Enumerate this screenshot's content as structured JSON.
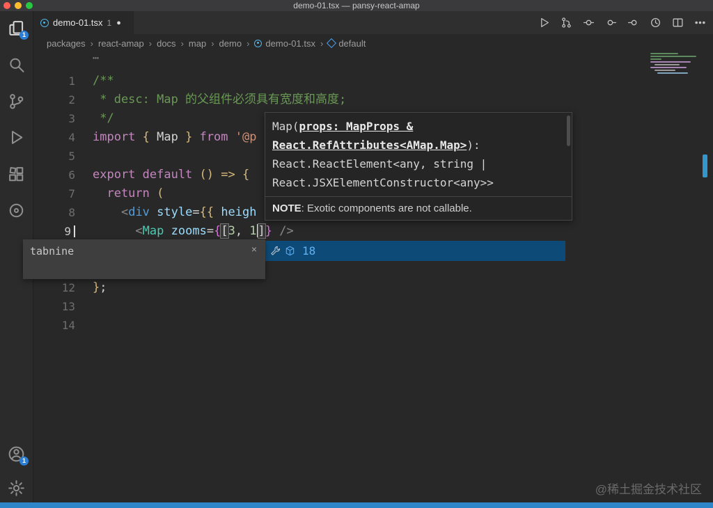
{
  "window": {
    "title": "demo-01.tsx — pansy-react-amap"
  },
  "tab": {
    "label": "demo-01.tsx",
    "count": "1",
    "modified": "●"
  },
  "toolbar": {
    "icons": [
      "run-icon",
      "open-changes-icon",
      "toolbar-circle-icon-1",
      "toolbar-circle-icon-2",
      "toolbar-circle-icon-3",
      "history-icon",
      "split-editor-icon",
      "more-actions-icon"
    ]
  },
  "activity": {
    "items": [
      "explorer-icon",
      "search-icon",
      "source-control-icon",
      "run-debug-icon",
      "extensions-icon",
      "circle-extension-icon",
      "accounts-icon",
      "settings-gear-icon"
    ],
    "explorer_badge": "1",
    "account_badge": "1"
  },
  "breadcrumb": {
    "separator": "›",
    "items": [
      {
        "label": "packages"
      },
      {
        "label": "react-amap"
      },
      {
        "label": "docs"
      },
      {
        "label": "map"
      },
      {
        "label": "demo"
      },
      {
        "label": "demo-01.tsx",
        "icon": "ts-file-icon"
      },
      {
        "label": "default",
        "icon": "symbol-icon"
      }
    ]
  },
  "editor": {
    "fold_ellipsis": "⋯",
    "lines": [
      {
        "num": "1",
        "segs": [
          [
            "/**",
            "comment"
          ]
        ]
      },
      {
        "num": "2",
        "segs": [
          [
            " * desc: Map 的父组件必须具有宽度和高度;",
            "comment"
          ]
        ]
      },
      {
        "num": "3",
        "segs": [
          [
            " */",
            "comment"
          ]
        ]
      },
      {
        "num": "4",
        "segs": [
          [
            "import ",
            "keyword"
          ],
          [
            "{",
            "gold"
          ],
          [
            " Map ",
            "plain"
          ],
          [
            "}",
            "gold"
          ],
          [
            " from ",
            "keyword"
          ],
          [
            "'@p",
            "string"
          ]
        ]
      },
      {
        "num": "5",
        "segs": []
      },
      {
        "num": "6",
        "segs": [
          [
            "export default ",
            "keyword"
          ],
          [
            "() ",
            "gold"
          ],
          [
            "=> ",
            "gold"
          ],
          [
            "{",
            "gold"
          ]
        ]
      },
      {
        "num": "7",
        "segs": [
          [
            "  return ",
            "keyword"
          ],
          [
            "(",
            "gold"
          ]
        ]
      },
      {
        "num": "8",
        "segs": [
          [
            "    ",
            "plain"
          ],
          [
            "<",
            "angle"
          ],
          [
            "div ",
            "tag"
          ],
          [
            "style",
            "attr"
          ],
          [
            "=",
            "plain"
          ],
          [
            "{{",
            "gold"
          ],
          [
            " heigh",
            "attr"
          ]
        ]
      },
      {
        "num": "9",
        "active": true,
        "segs": [
          [
            "      ",
            "plain"
          ],
          [
            "<",
            "angle"
          ],
          [
            "Map ",
            "component"
          ],
          [
            "zooms",
            "attr"
          ],
          [
            "=",
            "plain"
          ],
          [
            "{",
            "pink"
          ],
          [
            "[",
            "match"
          ],
          [
            "3",
            "number"
          ],
          [
            ", ",
            "plain"
          ],
          [
            "1",
            "number"
          ],
          [
            "",
            "caret"
          ],
          [
            "]",
            "match"
          ],
          [
            "}",
            "pink"
          ],
          [
            " />",
            "angle"
          ]
        ]
      },
      {
        "num": "10",
        "segs": []
      },
      {
        "num": "11",
        "segs": []
      },
      {
        "num": "12",
        "segs": [
          [
            "}",
            "gold"
          ],
          [
            ";",
            "plain"
          ]
        ]
      },
      {
        "num": "13",
        "segs": []
      },
      {
        "num": "14",
        "segs": []
      }
    ]
  },
  "hover": {
    "line1_pre": "Map(",
    "line1_link": "props: MapProps &",
    "line2_link": "React.RefAttributes<AMap.Map>",
    "line2_post": "):",
    "line3": "React.ReactElement<any, string |",
    "line4": "React.JSXElementConstructor<any>>",
    "note_label": "NOTE",
    "note_text": ": Exotic components are not callable."
  },
  "suggest": {
    "label": "18"
  },
  "tabnine": {
    "label": "tabnine",
    "close": "×"
  },
  "watermark": "@稀土掘金技术社区"
}
